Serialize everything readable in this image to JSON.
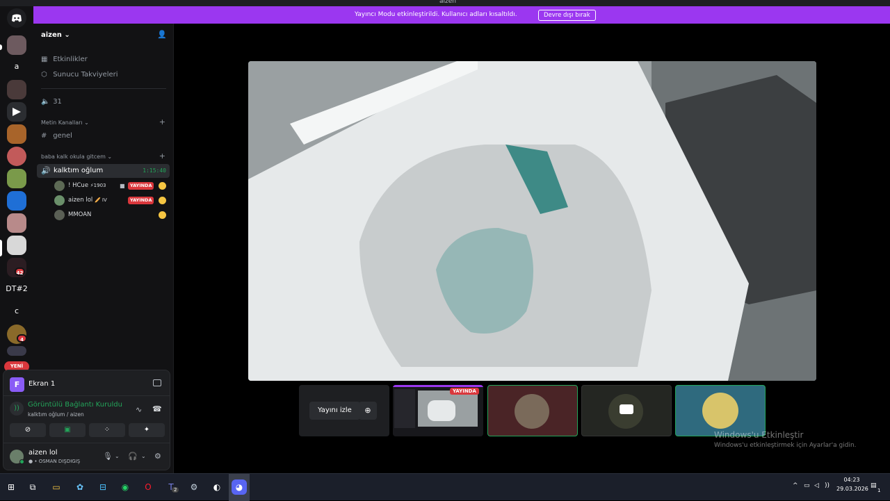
{
  "window": {
    "title": "aizen"
  },
  "banner": {
    "message": "Yayıncı Modu etkinleştirildi. Kullanıcı adları kısaltıldı.",
    "disable_label": "Devre dışı bırak"
  },
  "servers": {
    "text_items": [
      "a",
      "DT#2",
      "c"
    ],
    "badges": [
      "42",
      "4"
    ],
    "new_label": "YENİ"
  },
  "sidebar": {
    "guild_name": "aizen",
    "items": [
      {
        "icon": "calendar-icon",
        "label": "Etkinlikler"
      },
      {
        "icon": "boost-icon",
        "label": "Sunucu Takviyeleri"
      }
    ],
    "member_count": "31",
    "text_category": "Metin Kanalları",
    "text_channel": "genel",
    "voice_category": "baba kalk okula gitcem",
    "voice_channel": {
      "name": "kalktım oğlum",
      "timer": "1:15:40"
    },
    "members": [
      {
        "name": "! HCue",
        "tag": "⚡1903",
        "live": "YAYINDA",
        "camera": true
      },
      {
        "name": "aizen lol",
        "tag": "🥖 IV",
        "live": "YAYINDA",
        "camera": false
      },
      {
        "name": "MMOAN",
        "tag": "",
        "live": "",
        "camera": false
      }
    ]
  },
  "voice_panel": {
    "screen_label": "Ekran 1",
    "screen_initial": "F",
    "status": "Görüntülü Bağlantı Kuruldu",
    "location": "kalktım oğlum / aizen",
    "user": {
      "name": "aizen lol",
      "status": "OSMAN DIŞDIGIŞ"
    }
  },
  "stage": {
    "watch_label": "Yayını izle",
    "live_label": "YAYINDA"
  },
  "windows_activation": {
    "title": "Windows'u Etkinleştir",
    "subtitle": "Windows'u etkinleştirmek için Ayarlar'a gidin."
  },
  "taskbar": {
    "time": "04:23",
    "date": "29.03.2026",
    "teams_badge": "2",
    "notif_count": "1"
  },
  "colors": {
    "accent": "#9b37f0",
    "live_red": "#da373c",
    "online_green": "#23a55a"
  }
}
